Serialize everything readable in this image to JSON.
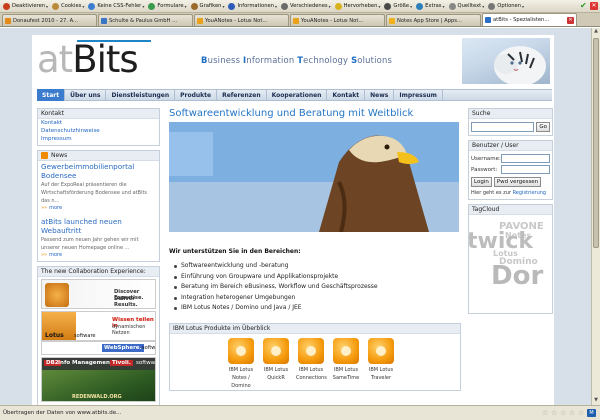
{
  "browser": {
    "toolbar": [
      {
        "label": "Deaktivieren",
        "icon": "deactivate-icon",
        "color": "#c93c1a"
      },
      {
        "label": "Cookies",
        "icon": "cookie-icon",
        "color": "#b98b3b"
      },
      {
        "label": "Keine CSS-Fehler",
        "icon": "css-icon",
        "color": "#3a7fcf"
      },
      {
        "label": "Formulare",
        "icon": "form-icon",
        "color": "#3a9b4f"
      },
      {
        "label": "Grafiken",
        "icon": "image-icon",
        "color": "#9b6b2c"
      },
      {
        "label": "Informationen",
        "icon": "info-icon",
        "color": "#2c5bb9"
      },
      {
        "label": "Verschiedenes",
        "icon": "misc-icon",
        "color": "#6b6b6b"
      },
      {
        "label": "Hervorheben",
        "icon": "highlight-icon",
        "color": "#d8b21c"
      },
      {
        "label": "Größe",
        "icon": "resize-icon",
        "color": "#4a4a4a"
      },
      {
        "label": "Extras",
        "icon": "tools-icon",
        "color": "#2c7fb8"
      },
      {
        "label": "Quelltext",
        "icon": "source-icon",
        "color": "#888888"
      },
      {
        "label": "Optionen",
        "icon": "options-icon",
        "color": "#777777"
      }
    ],
    "tabs": [
      {
        "label": "Donaufest 2010 - 27. A...",
        "color": "#e38b1a",
        "active": false
      },
      {
        "label": "Schulte & Paulus GmbH ...",
        "color": "#3a74c5",
        "active": false
      },
      {
        "label": "YouANotes - Lotus Not...",
        "color": "#e8a21c",
        "active": false
      },
      {
        "label": "YouANotes - Lotus Not...",
        "color": "#e8a21c",
        "active": false
      },
      {
        "label": "Notes App Store | Apps...",
        "color": "#f0b21c",
        "active": false
      },
      {
        "label": "atBits - Spezialisten...",
        "color": "#2d6dc6",
        "active": true
      }
    ],
    "status": "Übertragen der Daten von www.atbits.de..."
  },
  "header": {
    "logo_at": "at",
    "logo_bits": "Bits",
    "tagline": [
      {
        "cap": "B",
        "rest": "usiness "
      },
      {
        "cap": "I",
        "rest": "nformation "
      },
      {
        "cap": "T",
        "rest": "echnology "
      },
      {
        "cap": "S",
        "rest": "olutions"
      }
    ]
  },
  "nav": [
    "Start",
    "Über uns",
    "Dienstleistungen",
    "Produkte",
    "Referenzen",
    "Kooperationen",
    "Kontakt",
    "News",
    "Impressum"
  ],
  "left": {
    "kontakt_title": "Kontakt",
    "kontakt_links": [
      "Kontakt",
      "Datenschutzhinweise",
      "Impressum"
    ],
    "news_title": "News",
    "news": [
      {
        "heading": "Gewerbeimmobilienportal Bodensee",
        "text": "Auf der ExpoReal präsentieren die Wirtschaftsförderung Bodensee und atBits das n...",
        "more": "more"
      },
      {
        "heading": "atBits launched neuen Webauftritt",
        "text": "Passend zum neuen Jahr gehen wir mit unserer neuen Homepage online ...",
        "more": "more"
      }
    ],
    "collab_title": "The new Collaboration Experience:",
    "banner1": {
      "line1": "Discover Expertise.",
      "line2": "Deliver Results."
    },
    "banner2": {
      "brand": "Lotus",
      "sub": "software",
      "tag1": "Wissen teilen in",
      "tag2": "dynamischen Netzen"
    },
    "banner3": {
      "brand": "WebSphere.",
      "sub": "software"
    },
    "banner4": {
      "brand": "DB2",
      "sub": "Info Management",
      "brand2": "Tivoli.",
      "sub2": "software",
      "caption": "REDENWALD.ORG"
    }
  },
  "center": {
    "title": "Softwareentwicklung und Beratung mit Weitblick",
    "intro": "Wir unterstützen Sie in den Bereichen:",
    "bullets": [
      "Softwareentwicklung und -beratung",
      "Einführung von Groupware und Applikationsprojekte",
      "Beratung im Bereich eBusiness, Workflow und Geschäftsprozesse",
      "Integration heterogener Umgebungen",
      "IBM Lotus Notes / Domino und Java / JEE"
    ],
    "products_title": "IBM Lotus Produkte im Überblick",
    "products": [
      {
        "line1": "IBM Lotus",
        "line2": "Notes /",
        "line3": "Domino"
      },
      {
        "line1": "IBM Lotus",
        "line2": "QuickR",
        "line3": ""
      },
      {
        "line1": "IBM Lotus",
        "line2": "Connections",
        "line3": ""
      },
      {
        "line1": "IBM Lotus",
        "line2": "SameTime",
        "line3": ""
      },
      {
        "line1": "IBM Lotus",
        "line2": "Traveler",
        "line3": ""
      }
    ]
  },
  "right": {
    "search_title": "Suche",
    "search_button": "Go",
    "user_title": "Benutzer / User",
    "username_label": "Username:",
    "password_label": "Passwort:",
    "login_button": "Login",
    "forgot_button": "Pwd vergessen",
    "guest_text": "Hier geht es zur ",
    "register_link": "Registrierung",
    "tagcloud_title": "TagCloud",
    "tags": [
      "PAVONE",
      "Notes",
      "twick",
      "Lotus",
      "Domino",
      "Dor"
    ]
  }
}
